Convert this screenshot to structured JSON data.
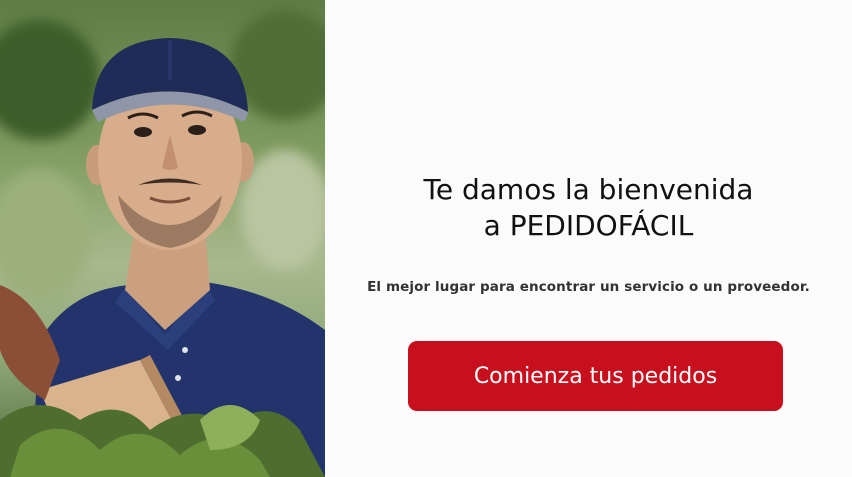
{
  "welcome": {
    "title_line1": "Te damos la bienvenida",
    "title_line2": "a PEDIDOFÁCIL",
    "subtitle": "El mejor lugar para encontrar un servicio o un proveedor.",
    "cta_label": "Comienza tus pedidos"
  },
  "colors": {
    "accent": "#c80f1e",
    "background": "#fbfbfb",
    "text": "#111111"
  },
  "hero": {
    "image_subject": "delivery-person-photo"
  }
}
